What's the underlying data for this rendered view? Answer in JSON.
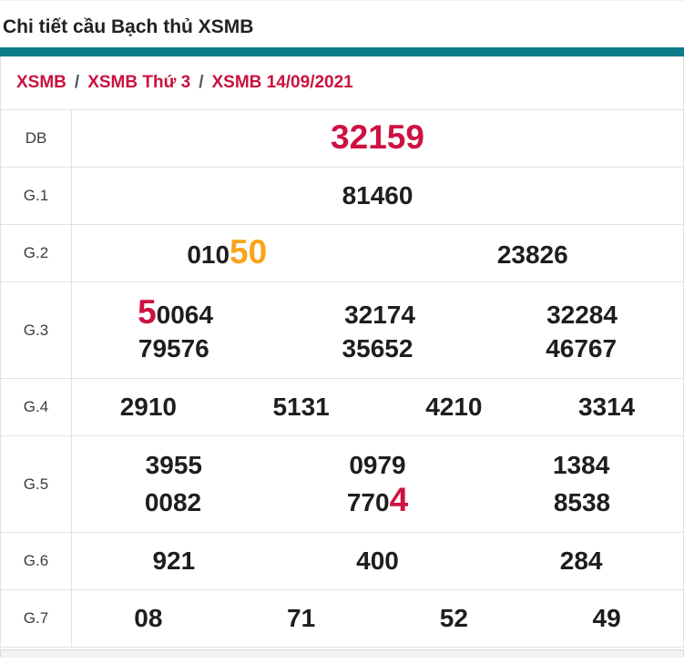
{
  "page": {
    "title": "Chi tiết cầu Bạch thủ XSMB"
  },
  "breadcrumb": {
    "separator": "/",
    "items": [
      "XSMB",
      "XSMB Thứ 3",
      "XSMB 14/09/2021"
    ]
  },
  "colors": {
    "accent_teal": "#0b7c87",
    "crimson": "#ce1141",
    "orange": "#f9a41b",
    "number_black": "#1e1e1e",
    "border": "#e2e2e2"
  },
  "results_table": {
    "rows": [
      {
        "label": "DB",
        "lines": [
          [
            {
              "parts": [
                {
                  "t": "32159",
                  "c": "crimson-big"
                }
              ]
            }
          ]
        ]
      },
      {
        "label": "G.1",
        "lines": [
          [
            {
              "parts": [
                {
                  "t": "81460"
                }
              ]
            }
          ]
        ]
      },
      {
        "label": "G.2",
        "lines": [
          [
            {
              "parts": [
                {
                  "t": "010"
                },
                {
                  "t": "50",
                  "c": "orange-big"
                }
              ]
            },
            {
              "parts": [
                {
                  "t": "23826"
                }
              ]
            }
          ]
        ]
      },
      {
        "label": "G.3",
        "lines": [
          [
            {
              "parts": [
                {
                  "t": "5",
                  "c": "crimson-big"
                },
                {
                  "t": "0064"
                }
              ]
            },
            {
              "parts": [
                {
                  "t": "32174"
                }
              ]
            },
            {
              "parts": [
                {
                  "t": "32284"
                }
              ]
            }
          ],
          [
            {
              "parts": [
                {
                  "t": "79576"
                }
              ]
            },
            {
              "parts": [
                {
                  "t": "35652"
                }
              ]
            },
            {
              "parts": [
                {
                  "t": "46767"
                }
              ]
            }
          ]
        ]
      },
      {
        "label": "G.4",
        "lines": [
          [
            {
              "parts": [
                {
                  "t": "2910"
                }
              ]
            },
            {
              "parts": [
                {
                  "t": "5131"
                }
              ]
            },
            {
              "parts": [
                {
                  "t": "4210"
                }
              ]
            },
            {
              "parts": [
                {
                  "t": "3314"
                }
              ]
            }
          ]
        ]
      },
      {
        "label": "G.5",
        "lines": [
          [
            {
              "parts": [
                {
                  "t": "3955"
                }
              ]
            },
            {
              "parts": [
                {
                  "t": "0979"
                }
              ]
            },
            {
              "parts": [
                {
                  "t": "1384"
                }
              ]
            }
          ],
          [
            {
              "parts": [
                {
                  "t": "0082"
                }
              ]
            },
            {
              "parts": [
                {
                  "t": "770"
                },
                {
                  "t": "4",
                  "c": "crimson-big"
                }
              ]
            },
            {
              "parts": [
                {
                  "t": "8538"
                }
              ]
            }
          ]
        ]
      },
      {
        "label": "G.6",
        "lines": [
          [
            {
              "parts": [
                {
                  "t": "921"
                }
              ]
            },
            {
              "parts": [
                {
                  "t": "400"
                }
              ]
            },
            {
              "parts": [
                {
                  "t": "284"
                }
              ]
            }
          ]
        ]
      },
      {
        "label": "G.7",
        "lines": [
          [
            {
              "parts": [
                {
                  "t": "08"
                }
              ]
            },
            {
              "parts": [
                {
                  "t": "71"
                }
              ]
            },
            {
              "parts": [
                {
                  "t": "52"
                }
              ]
            },
            {
              "parts": [
                {
                  "t": "49"
                }
              ]
            }
          ]
        ]
      }
    ]
  }
}
